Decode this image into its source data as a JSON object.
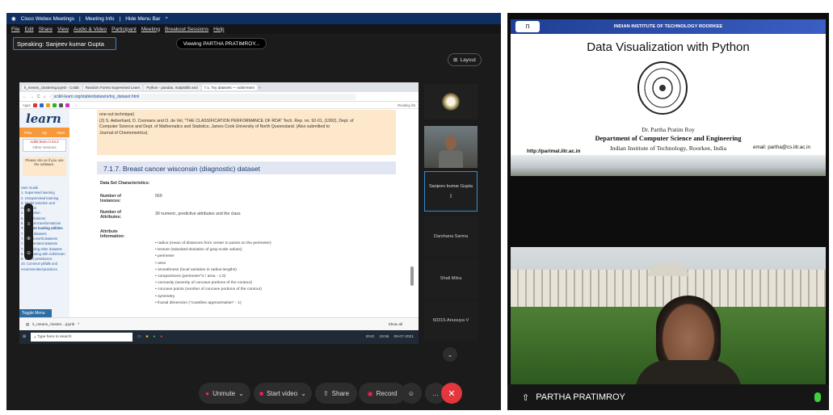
{
  "left": {
    "titlebar": {
      "app": "Cisco Webex Meetings",
      "info": "Meeting Info",
      "hide": "Hide Menu Bar"
    },
    "menu": [
      "File",
      "Edit",
      "Share",
      "View",
      "Audio & Video",
      "Participant",
      "Meeting",
      "Breakout Sessions",
      "Help"
    ],
    "speaking": "Speaking: Sanjeev kumar Gupta",
    "viewing": "Viewing PARTHA PRATIMROY...",
    "layout": "Layout",
    "browser": {
      "tabs": [
        "k_means_clustering.ipynb - Colab",
        "Random Forest Supervised Learn",
        "Python - pandas, matplotlib and",
        "7.1. Toy datasets — scikit-learn"
      ],
      "url": "scikit-learn.org/stable/datasets/toy_dataset.html",
      "bookmarks": [
        "Apps",
        "Reading list"
      ]
    },
    "sklearn": {
      "logo": "learn",
      "nav": [
        "Prev",
        "Up",
        "Next"
      ],
      "version": "scikit-learn 0.24.2",
      "other_versions": "Other versions",
      "cite": "Please cite us if you use the software.",
      "toc": [
        "User Guide",
        "1. Supervised learning",
        "2. Unsupervised learning",
        "3. Model selection and evaluation",
        "4. Inspection",
        "5. Visualizations",
        "6. Dataset transformations",
        "7. Dataset loading utilities",
        "7.1. Toy datasets",
        "7.2. Real world datasets",
        "7.3. Generated datasets",
        "7.4. Loading other datasets",
        "8. Computing with scikit-learn",
        "9. Model persistence",
        "10. Common pitfalls and recommended practices"
      ],
      "toggle": "Toggle Menu",
      "quote_lines": [
        "one-out technique)",
        "(2) S. Aeberhard, D. Coomans and O. de Vel, \"THE CLASSIFICATION PERFORMANCE OF RDA\" Tech. Rep. no. 92-01, (1992), Dept. of",
        "Computer Science and Dept. of Mathematics and Statistics, James Cook University of North Queensland. (Also submitted to",
        "Journal of Chemometrics)."
      ],
      "heading": "7.1.7. Breast cancer wisconsin (diagnostic) dataset",
      "ds_title": "Data Set Characteristics:",
      "rows": [
        {
          "k": "Number of Instances:",
          "v": "569"
        },
        {
          "k": "Number of Attributes:",
          "v": "30 numeric, predictive attributes and the class"
        },
        {
          "k": "Attribute Information:",
          "v": ""
        }
      ],
      "attributes": [
        "radius (mean of distances from center to points on the perimeter)",
        "texture (standard deviation of gray-scale values)",
        "perimeter",
        "area",
        "smoothness (local variation in radius lengths)",
        "compactness (perimeter^2 / area - 1.0)",
        "concavity (severity of concave portions of the contour)",
        "concave points (number of concave portions of the contour)",
        "symmetry",
        "fractal dimension (\"coastline approximation\" - 1)"
      ]
    },
    "download": {
      "file": "k_means_clusteri....ipynb",
      "show_all": "Show all"
    },
    "taskbar": {
      "search": "Type here to search",
      "time": "19:55",
      "date": "09-07-2021",
      "lang": "ENG"
    },
    "participants": [
      {
        "name": "Sanjeev kumar Gupta"
      },
      {
        "name": "Darshana Sarma"
      },
      {
        "name": "Shali Mitra"
      },
      {
        "name": "60315-Anusuya V"
      }
    ],
    "controls": {
      "unmute": "Unmute",
      "start_video": "Start video",
      "share": "Share",
      "record": "Record"
    }
  },
  "right": {
    "header": "INDIAN INSTITUTE OF TECHNOLOGY ROORKEE",
    "logo_letter": "n",
    "title": "Data Visualization with Python",
    "prof": "Dr. Partha Pratim Roy",
    "dept": "Department of Computer Science and Engineering",
    "inst": "Indian Institute of Technology, Roorkee, India",
    "url": "http://parimal.iitr.ac.in",
    "email": "email: partha@cs.iitr.ac.in",
    "presenter": "PARTHA PRATIMROY"
  }
}
